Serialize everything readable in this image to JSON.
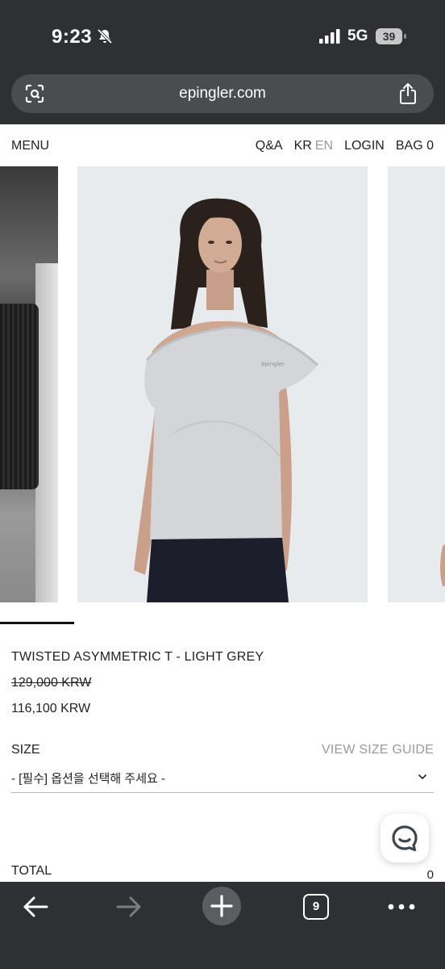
{
  "status_bar": {
    "time": "9:23",
    "network": "5G",
    "battery": "39"
  },
  "browser": {
    "url": "epingler.com",
    "open_tabs": "9"
  },
  "site_nav": {
    "menu": "MENU",
    "qa": "Q&A",
    "lang_kr": "KR",
    "lang_en": "EN",
    "login": "LOGIN",
    "bag": "BAG 0"
  },
  "product": {
    "title": "TWISTED ASYMMETRIC T - LIGHT GREY",
    "original_price": "129,000 KRW",
    "sale_price": "116,100 KRW",
    "size_label": "SIZE",
    "size_guide": "VIEW SIZE GUIDE",
    "size_select": "- [필수] 옵션을 선택해 주세요 -",
    "tee_logo_text": "épingler"
  },
  "total": {
    "label": "TOTAL",
    "value": "0"
  },
  "colors": {
    "chrome": "#2e3033",
    "accent_text": "#222222",
    "muted_text": "#9a9a9a"
  },
  "icons": {
    "status": [
      "bell-slash-icon",
      "signal-icon",
      "battery-icon"
    ],
    "address": [
      "lens-icon",
      "share-icon"
    ],
    "toolbar": [
      "arrow-left-icon",
      "arrow-right-icon",
      "plus-icon",
      "tabs-icon",
      "more-icon"
    ],
    "chat": "chat-icon"
  }
}
